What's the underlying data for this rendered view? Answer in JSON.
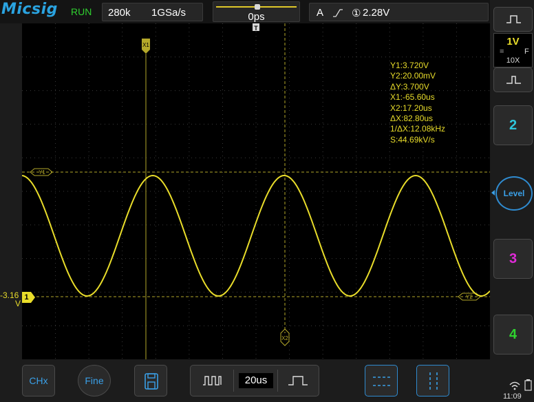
{
  "header": {
    "logo": "Micsig",
    "run_state": "RUN",
    "memory_depth": "280k",
    "sample_rate": "1GSa/s",
    "trigger_position": "0ps",
    "trigger_mode": "A",
    "trigger_source": "①",
    "trigger_level": "2.28V"
  },
  "screen": {
    "cursor_x1_label": "X1",
    "cursor_x2_label": "X2",
    "cursor_y1_label": "Y1",
    "cursor_y2_label": "Y2",
    "ch1_offset_label_line1": "-3.16",
    "ch1_offset_label_line2": "V",
    "ch1_marker": "1",
    "trace_color": "#e9dd2a"
  },
  "measurements": {
    "y1": "Y1:3.720V",
    "y2": "Y2:20.00mV",
    "dy": "ΔY:3.700V",
    "x1": "X1:-65.60us",
    "x2": "X2:17.20us",
    "dx": "ΔX:82.80us",
    "inv_dx": "1/ΔX:12.08kHz",
    "slope": "S:44.69kV/s"
  },
  "right_panel": {
    "ch1_volts_div": "1V",
    "ch1_coupling": "=",
    "ch1_bw": "F",
    "ch1_probe": "10X",
    "ch2_label": "2",
    "ch3_label": "3",
    "ch4_label": "4",
    "level_label": "Level",
    "ch2_color": "#2fc6dc",
    "ch3_color": "#e02ad8",
    "ch4_color": "#2fd12f"
  },
  "bottom_bar": {
    "chx_label": "CHx",
    "fine_label": "Fine",
    "timebase": "20us",
    "clock": "11:09"
  }
}
